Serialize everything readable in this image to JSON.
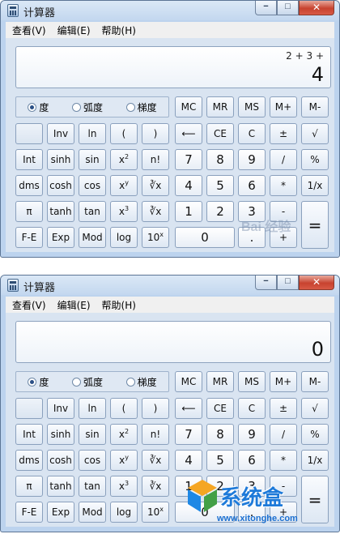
{
  "app": {
    "title": "计算器",
    "title_bar_minimize": "−",
    "title_bar_maximize": "□",
    "title_bar_close": "✕"
  },
  "menu": [
    "查看(V)",
    "编辑(E)",
    "帮助(H)"
  ],
  "windows": [
    {
      "display_expression": "2 + 3 +",
      "display_value": "4"
    },
    {
      "display_expression": "",
      "display_value": "0"
    }
  ],
  "radios": [
    {
      "label": "度",
      "checked": true
    },
    {
      "label": "弧度",
      "checked": false
    },
    {
      "label": "梯度",
      "checked": false
    }
  ],
  "keys": {
    "mc": "MC",
    "mr": "MR",
    "ms": "MS",
    "mplus": "M+",
    "mminus": "M-",
    "inv": "Inv",
    "ln": "ln",
    "lparen": "(",
    "rparen": ")",
    "back": "⟵",
    "ce": "CE",
    "c": "C",
    "plusminus": "±",
    "sqrt": "√",
    "int": "Int",
    "sinh": "sinh",
    "sin": "sin",
    "x2": "x",
    "x2_sup": "2",
    "fact": "n!",
    "n7": "7",
    "n8": "8",
    "n9": "9",
    "div": "/",
    "pct": "%",
    "dms": "dms",
    "cosh": "cosh",
    "cos": "cos",
    "xy": "x",
    "xy_sup": "y",
    "yroot": "∛x",
    "yroot_sup": "y",
    "n4": "4",
    "n5": "5",
    "n6": "6",
    "mul": "*",
    "recip": "1/x",
    "pi": "π",
    "tanh": "tanh",
    "tan": "tan",
    "x3": "x",
    "x3_sup": "3",
    "cuberoot": "∛x",
    "n1": "1",
    "n2": "2",
    "n3": "3",
    "sub": "-",
    "eq": "=",
    "fe": "F-E",
    "exp": "Exp",
    "mod": "Mod",
    "log": "log",
    "ten": "10",
    "ten_sup": "x",
    "n0": "0",
    "dot": ".",
    "add": "+"
  },
  "watermarks": {
    "top": "Bai 经验",
    "bottom_text": "系统盒",
    "bottom_url": "www.xitonghe.com"
  }
}
